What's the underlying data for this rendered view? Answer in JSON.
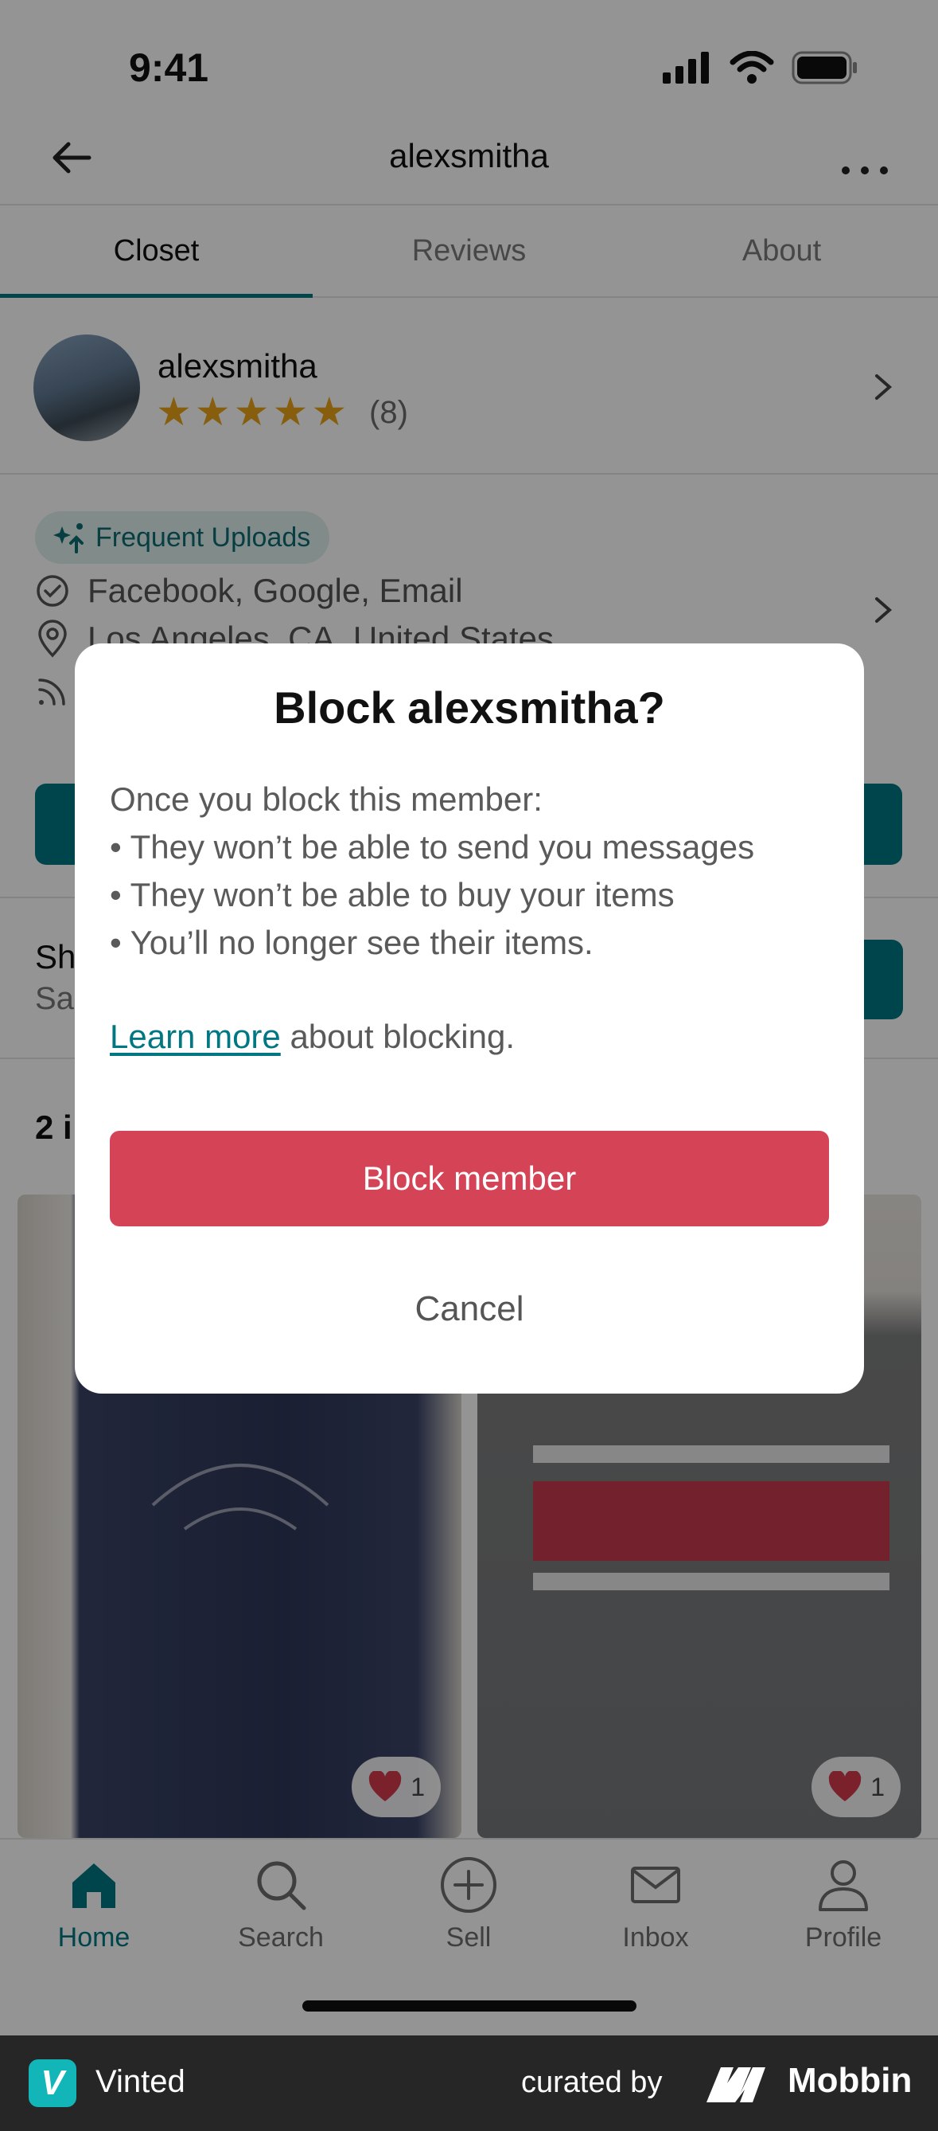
{
  "status_bar": {
    "time": "9:41"
  },
  "nav": {
    "title": "alexsmitha"
  },
  "tabs": [
    {
      "label": "Closet",
      "active": true
    },
    {
      "label": "Reviews",
      "active": false
    },
    {
      "label": "About",
      "active": false
    }
  ],
  "profile": {
    "name": "alexsmitha",
    "rating": 5,
    "review_count": "(8)"
  },
  "info": {
    "badge": "Frequent Uploads",
    "verified": "Facebook, Google, Email",
    "location": "Los Angeles, CA, United States"
  },
  "shop": {
    "title": "Sh",
    "subtitle": "Sa"
  },
  "items": {
    "count_label": "2 i"
  },
  "listings": [
    {
      "favorites": "1"
    },
    {
      "favorites": "1"
    }
  ],
  "tabbar": [
    {
      "label": "Home",
      "icon": "home-icon",
      "active": true
    },
    {
      "label": "Search",
      "icon": "search-icon",
      "active": false
    },
    {
      "label": "Sell",
      "icon": "plus-circle-icon",
      "active": false
    },
    {
      "label": "Inbox",
      "icon": "mail-icon",
      "active": false
    },
    {
      "label": "Profile",
      "icon": "person-icon",
      "active": false
    }
  ],
  "dialog": {
    "title": "Block alexsmitha?",
    "intro": "Once you block this member:",
    "bullets": [
      "• They won’t be able to send you messages",
      "• They won’t be able to buy your items",
      "• You’ll no longer see their items."
    ],
    "learn_link": "Learn more",
    "learn_rest": " about blocking.",
    "block_label": "Block member",
    "cancel_label": "Cancel"
  },
  "footer": {
    "brand": "Vinted",
    "brand_letter": "V",
    "curated": "curated by",
    "mobbin": "Mobbin"
  },
  "colors": {
    "accent": "#007782",
    "danger": "#d54456",
    "star": "#e8a317",
    "footer_bg": "#262626"
  }
}
